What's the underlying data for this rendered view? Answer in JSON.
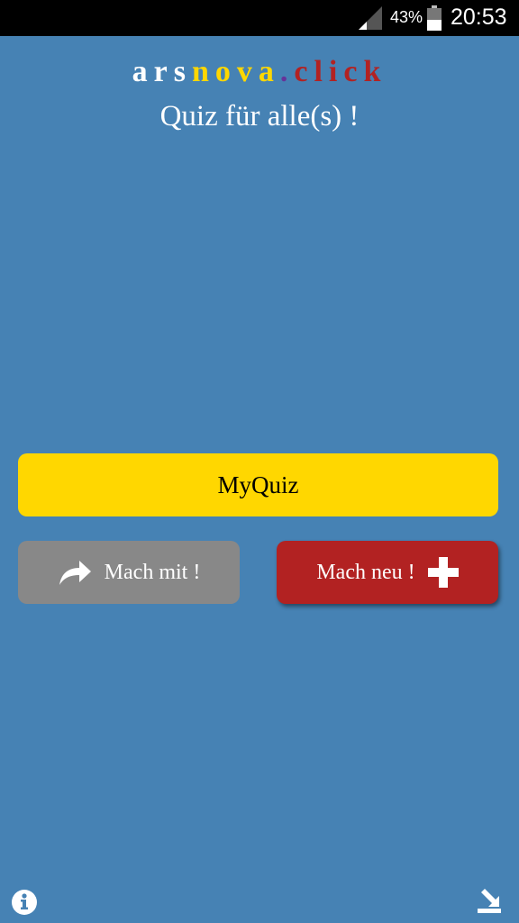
{
  "status_bar": {
    "battery_percent": "43%",
    "time": "20:53",
    "icons": [
      "signal-icon",
      "battery-icon"
    ]
  },
  "logo": {
    "part1": "ars",
    "part2": "nova",
    "part3": ".",
    "part4": "click",
    "colors": {
      "part1": "#ffffff",
      "part2": "#ffd700",
      "part3": "#663399",
      "part4": "#b22222"
    }
  },
  "tagline": "Quiz für alle(s) !",
  "buttons": {
    "myquiz": "MyQuiz",
    "join": "Mach mit !",
    "new": "Mach neu !"
  },
  "colors": {
    "background": "#4682b4",
    "myquiz": "#ffd700",
    "join": "#888888",
    "new": "#b22222"
  },
  "footer": {
    "left_icon": "info-icon",
    "right_icon": "install-icon"
  }
}
